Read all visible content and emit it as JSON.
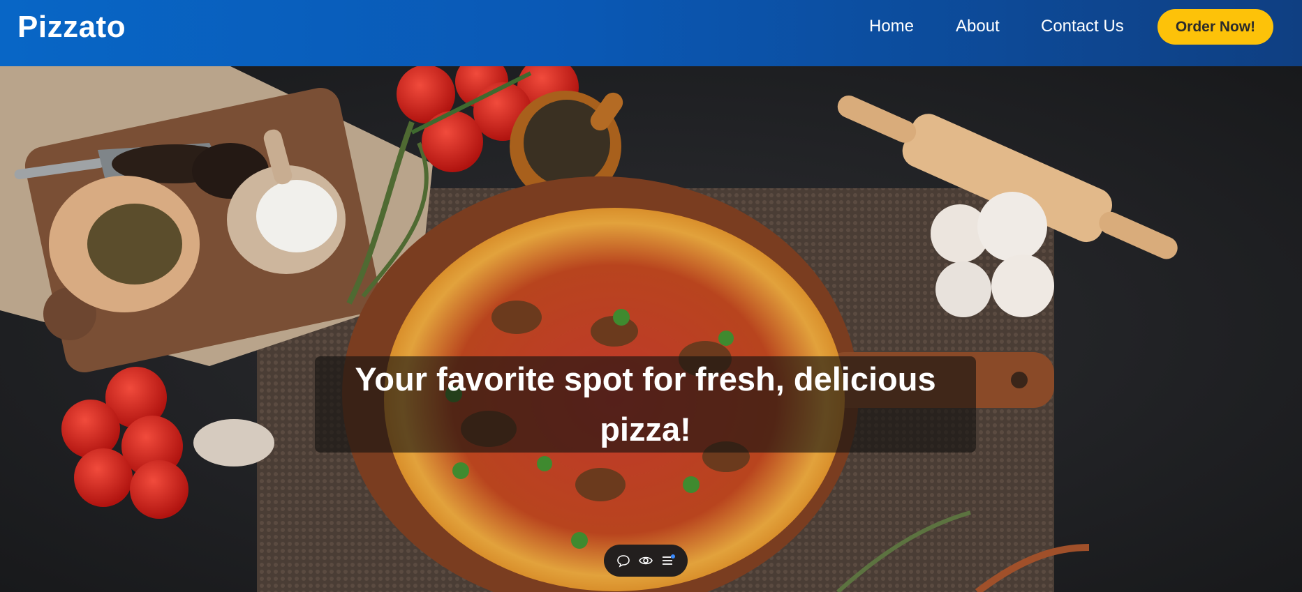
{
  "brand": {
    "name": "Pizzato"
  },
  "nav": {
    "links": [
      {
        "label": "Home"
      },
      {
        "label": "About"
      },
      {
        "label": "Contact Us"
      }
    ],
    "cta_label": "Order Now!"
  },
  "hero": {
    "headline": "Your favorite spot for fresh, delicious pizza!",
    "image_alt": "Pizza on wooden board surrounded by tomatoes, spices, mushrooms, garlic and a rolling pin"
  },
  "floating_toolbar": {
    "icons": [
      "comment-icon",
      "eye-icon",
      "menu-icon"
    ]
  },
  "colors": {
    "nav_gradient_start": "#0866c6",
    "nav_gradient_end": "#0f3f82",
    "cta_background": "#fdc209",
    "text_light": "#ffffff"
  }
}
